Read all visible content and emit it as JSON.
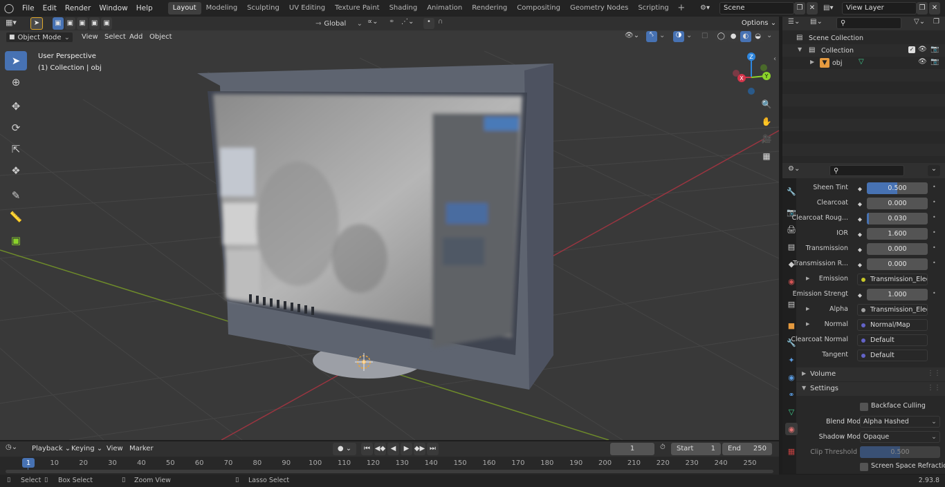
{
  "topbar": {
    "menus": [
      "File",
      "Edit",
      "Render",
      "Window",
      "Help"
    ],
    "workspaces": [
      "Layout",
      "Modeling",
      "Sculpting",
      "UV Editing",
      "Texture Paint",
      "Shading",
      "Animation",
      "Rendering",
      "Compositing",
      "Geometry Nodes",
      "Scripting"
    ],
    "active_workspace": "Layout",
    "add_tab_icon": "plus-icon",
    "scene": "Scene",
    "view_layer": "View Layer"
  },
  "toolheader": {
    "orientation": "Global",
    "options": "Options"
  },
  "viewport_header": {
    "mode": "Object Mode",
    "menus": [
      "View",
      "Select",
      "Add",
      "Object"
    ]
  },
  "viewport": {
    "perspective": "User Perspective",
    "collection_info": "(1) Collection | obj",
    "gizmo": {
      "x": "X",
      "y": "Y",
      "z": "Z"
    }
  },
  "toolbar": {
    "tools": [
      "select-box-icon",
      "cursor-icon",
      "move-icon",
      "rotate-icon",
      "scale-icon",
      "transform-icon",
      "annotate-icon",
      "measure-icon",
      "add-cube-icon"
    ]
  },
  "outliner": {
    "search_placeholder": "",
    "rows": [
      {
        "label": "Scene Collection"
      },
      {
        "label": "Collection"
      },
      {
        "label": "obj"
      }
    ]
  },
  "properties": {
    "search_placeholder": "",
    "rows": [
      {
        "label": "Sheen Tint",
        "value": "0.500",
        "fraction": 0.5
      },
      {
        "label": "Clearcoat",
        "value": "0.000",
        "fraction": 0.0
      },
      {
        "label": "Clearcoat Roug...",
        "value": "0.030",
        "fraction": 0.03
      },
      {
        "label": "IOR",
        "value": "1.600",
        "fraction": 0.0
      },
      {
        "label": "Transmission",
        "value": "0.000",
        "fraction": 0.0
      },
      {
        "label": "Transmission R...",
        "value": "0.000",
        "fraction": 0.0
      },
      {
        "label": "Emission",
        "link": "Transmission_Electr...",
        "color": "#c7c729"
      },
      {
        "label": "Emission Strengt",
        "value": "1.000",
        "fraction": 0.0
      },
      {
        "label": "Alpha",
        "link": "Transmission_Electr...",
        "color": "#a1a1a1"
      },
      {
        "label": "Normal",
        "link": "Normal/Map",
        "color": "#6363c7"
      },
      {
        "label": "Clearcoat Normal",
        "link": "Default",
        "color": "#6363c7"
      },
      {
        "label": "Tangent",
        "link": "Default",
        "color": "#6363c7"
      }
    ],
    "volume_label": "Volume",
    "settings_label": "Settings",
    "backface_culling": "Backface Culling",
    "blend_mode_label": "Blend Mode",
    "blend_mode": "Alpha Hashed",
    "shadow_mode_label": "Shadow Mode",
    "shadow_mode": "Opaque",
    "clip_threshold_label": "Clip Threshold",
    "clip_threshold": "0.500",
    "clip_fraction": 0.5,
    "screen_space_refraction": "Screen Space Refraction"
  },
  "timeline": {
    "menus": [
      "Playback",
      "Keying",
      "View",
      "Marker"
    ],
    "current_frame": "1",
    "start_label": "Start",
    "start": "1",
    "end_label": "End",
    "end": "250",
    "ticks": [
      "1",
      "10",
      "20",
      "30",
      "40",
      "50",
      "60",
      "70",
      "80",
      "90",
      "100",
      "110",
      "120",
      "130",
      "140",
      "150",
      "160",
      "170",
      "180",
      "190",
      "200",
      "210",
      "220",
      "230",
      "240",
      "250"
    ]
  },
  "status": {
    "items": [
      "Select",
      "Box Select",
      "Zoom View",
      "Lasso Select"
    ],
    "version": "2.93.8"
  },
  "colors": {
    "accent": "#4772b3",
    "x_axis": "#d3344a",
    "y_axis": "#8bd32a",
    "z_axis": "#2e86de"
  }
}
